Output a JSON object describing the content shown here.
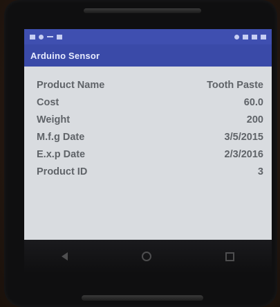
{
  "app": {
    "title": "Arduino Sensor"
  },
  "product": {
    "rows": [
      {
        "label": "Product Name",
        "value": "Tooth Paste"
      },
      {
        "label": "Cost",
        "value": "60.0"
      },
      {
        "label": "Weight",
        "value": "200"
      },
      {
        "label": "M.f.g Date",
        "value": "3/5/2015"
      },
      {
        "label": "E.x.p Date",
        "value": "2/3/2016"
      },
      {
        "label": "Product ID",
        "value": "3"
      }
    ]
  },
  "colors": {
    "app_bar": "#3a4aa8",
    "status_bar": "#3f4fb0",
    "screen_bg": "#d9dce0",
    "text": "#5f6368"
  },
  "icons": {
    "status_left": [
      "notification-icon",
      "message-icon",
      "minus-icon",
      "mail-icon"
    ],
    "status_right": [
      "location-icon",
      "wifi-icon",
      "signal-icon",
      "battery-icon"
    ],
    "nav": [
      "back-icon",
      "home-icon",
      "recent-apps-icon"
    ]
  }
}
